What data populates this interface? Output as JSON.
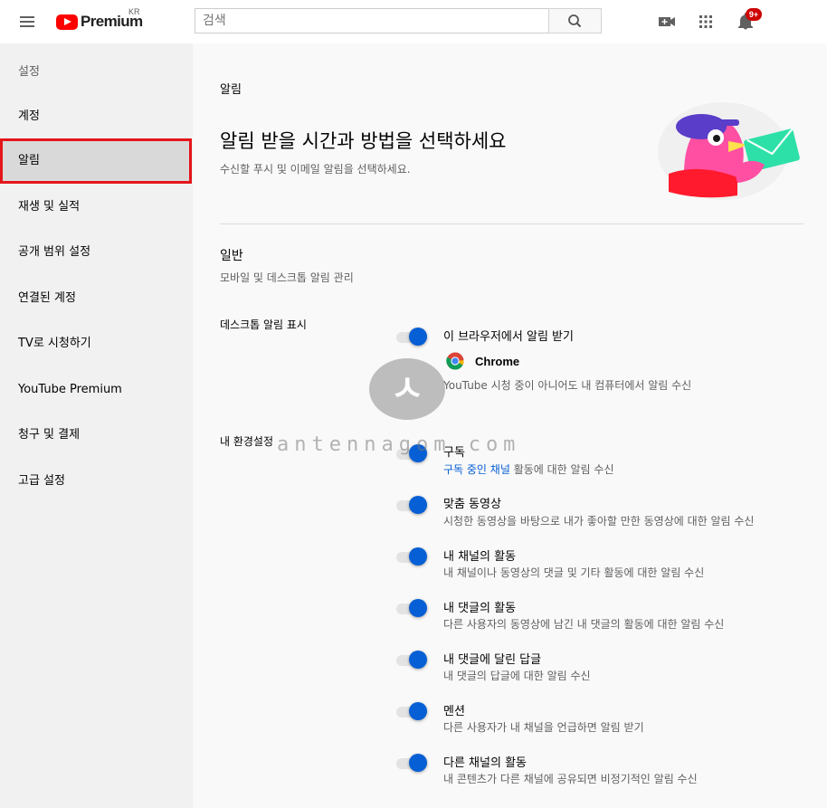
{
  "header": {
    "logo_text": "Premium",
    "logo_region": "KR",
    "search_placeholder": "검색",
    "notification_count": "9+"
  },
  "sidebar": {
    "heading": "설정",
    "items": [
      {
        "label": "계정"
      },
      {
        "label": "알림"
      },
      {
        "label": "재생 및 실적"
      },
      {
        "label": "공개 범위 설정"
      },
      {
        "label": "연결된 계정"
      },
      {
        "label": "TV로 시청하기"
      },
      {
        "label": "YouTube Premium"
      },
      {
        "label": "청구 및 결제"
      },
      {
        "label": "고급 설정"
      }
    ],
    "active_index": 1
  },
  "main": {
    "breadcrumb": "알림",
    "title": "알림 받을 시간과 방법을 선택하세요",
    "subtitle": "수신할 푸시 및 이메일 알림을 선택하세요.",
    "general": {
      "title": "일반",
      "desc": "모바일 및 데스크톱 알림 관리"
    },
    "desktop": {
      "label": "데스크톱 알림 표시",
      "toggle_label": "이 브라우저에서 알림 받기",
      "browser": "Chrome",
      "desc": "YouTube 시청 중이 아니어도 내 컴퓨터에서 알림 수신"
    },
    "prefs": {
      "label": "내 환경설정",
      "items": [
        {
          "title": "구독",
          "desc_link": "구독 중인 채널",
          "desc": " 활동에 대한 알림 수신"
        },
        {
          "title": "맞춤 동영상",
          "desc": "시청한 동영상을 바탕으로 내가 좋아할 만한 동영상에 대한 알림 수신"
        },
        {
          "title": "내 채널의 활동",
          "desc": "내 채널이나 동영상의 댓글 및 기타 활동에 대한 알림 수신"
        },
        {
          "title": "내 댓글의 활동",
          "desc": "다른 사용자의 동영상에 남긴 내 댓글의 활동에 대한 알림 수신"
        },
        {
          "title": "내 댓글에 달린 답글",
          "desc": "내 댓글의 답글에 대한 알림 수신"
        },
        {
          "title": "멘션",
          "desc": "다른 사용자가 내 채널을 언급하면 알림 받기"
        },
        {
          "title": "다른 채널의 활동",
          "desc": "내 콘텐츠가 다른 채널에 공유되면 비정기적인 알림 수신"
        }
      ]
    }
  },
  "watermark": {
    "glyph": "ㅅ",
    "text": "antennagom.com"
  },
  "colors": {
    "accent_blue": "#065fd4",
    "youtube_red": "#ff0000",
    "highlight_red": "#e4151b"
  }
}
